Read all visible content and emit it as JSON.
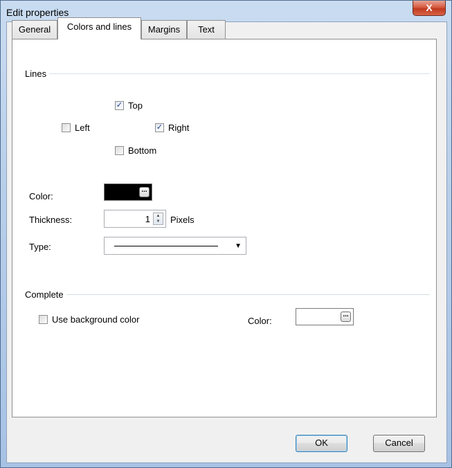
{
  "window": {
    "title": "Edit properties",
    "close_label": "X"
  },
  "tabs": [
    {
      "label": "General"
    },
    {
      "label": "Colors and lines"
    },
    {
      "label": "Margins"
    },
    {
      "label": "Text"
    }
  ],
  "lines": {
    "group_title": "Lines",
    "top": {
      "label": "Top",
      "checked": true
    },
    "left": {
      "label": "Left",
      "checked": false
    },
    "right": {
      "label": "Right",
      "checked": true
    },
    "bottom": {
      "label": "Bottom",
      "checked": false
    },
    "color_label": "Color:",
    "color_value": "#000000",
    "thickness_label": "Thickness:",
    "thickness_value": "1",
    "thickness_unit": "Pixels",
    "type_label": "Type:"
  },
  "complete": {
    "group_title": "Complete",
    "use_bg": {
      "label": "Use background color",
      "checked": false
    },
    "color_label": "Color:",
    "color_value": "#ffffff"
  },
  "buttons": {
    "ok": "OK",
    "cancel": "Cancel"
  },
  "icons": {
    "ellipsis": "...",
    "check": "✓",
    "dropdown": "▼",
    "spin_up": "▲",
    "spin_down": "▼"
  }
}
